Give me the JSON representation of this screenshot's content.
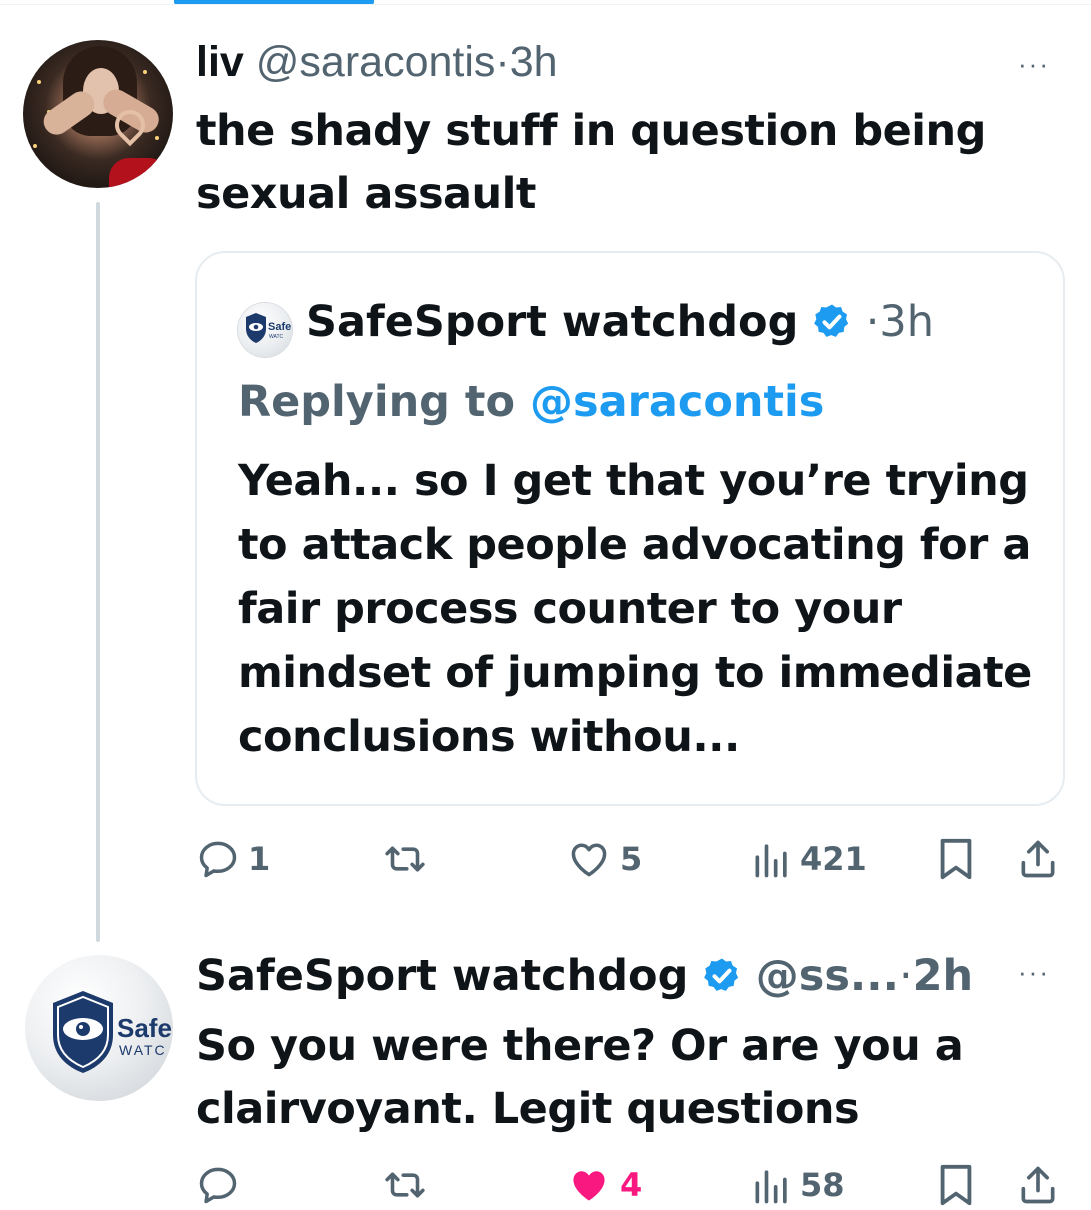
{
  "tweet1": {
    "display_name": "liv",
    "handle": "@saracontis",
    "separator": "·",
    "time": "3h",
    "more": "···",
    "text": "the shady stuff in question being sexual assault"
  },
  "quote": {
    "display_name": "SafeSport watchdog",
    "separator": "·",
    "time": "3h",
    "avatar_text_top": "Safe",
    "avatar_text_bottom": "WATC",
    "replying_label": "Replying to",
    "replying_handle": "@saracontis",
    "text": "Yeah... so I get that you’re trying to attack people advocating for a fair process counter to your mindset of jumping to immediate conclusions withou..."
  },
  "actions1": {
    "replies": "1",
    "retweets": "",
    "likes": "5",
    "views": "421"
  },
  "tweet2": {
    "display_name": "SafeSport watchdog",
    "handle": "@ss...",
    "separator": "·",
    "time": "2h",
    "more": "···",
    "avatar_text_top": "Safe",
    "avatar_text_bottom": "WATC",
    "text": "So you were there? Or are you a clairvoyant. Legit questions"
  },
  "actions2": {
    "replies": "",
    "retweets": "",
    "likes": "4",
    "views": "58"
  },
  "colors": {
    "accent": "#1d9bf0",
    "muted": "#536471",
    "like": "#f91880",
    "border": "#e6ecf0"
  }
}
